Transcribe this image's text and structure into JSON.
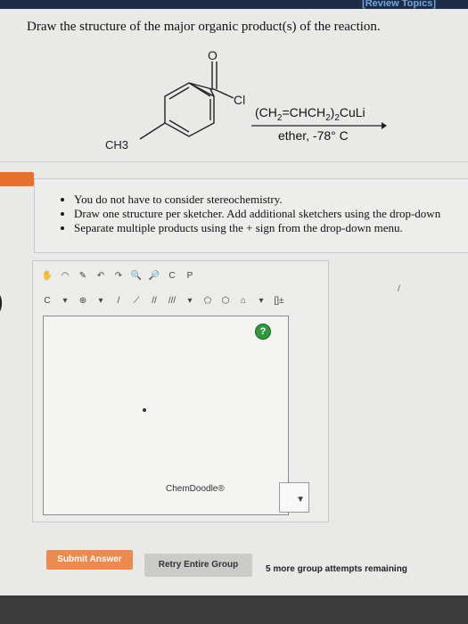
{
  "header": {
    "review_link": "[Review Topics]"
  },
  "question": {
    "text": "Draw the structure of the major organic product(s) of the reaction."
  },
  "reaction": {
    "reactant_labels": {
      "carbonyl_o": "O",
      "chloride": "Cl",
      "methyl": "CH3"
    },
    "reagent_parts": [
      "(CH",
      "2",
      "=CHCH",
      "2",
      ")",
      "2",
      "CuLi"
    ],
    "conditions": "ether, -78° C"
  },
  "instructions": [
    "You do not have to consider stereochemistry.",
    "Draw one structure per sketcher. Add additional sketchers using the drop-down",
    "Separate multiple products using the + sign from the drop-down menu."
  ],
  "sketcher": {
    "help_label": "?",
    "brand": "ChemDoodle®",
    "tool_c_label": "C",
    "tool_copy_label": "C",
    "tool_paste_label": "P",
    "tool_charge_label": "⊕",
    "bracket_label": "[]±"
  },
  "buttons": {
    "submit": "Submit Answer",
    "retry": "Retry Entire Group"
  },
  "status": {
    "attempts": "5 more group attempts remaining"
  },
  "colors": {
    "submit_bg": "#ee8a4e",
    "help_bg": "#2e9a3a",
    "topbar": "#1f2c46"
  }
}
